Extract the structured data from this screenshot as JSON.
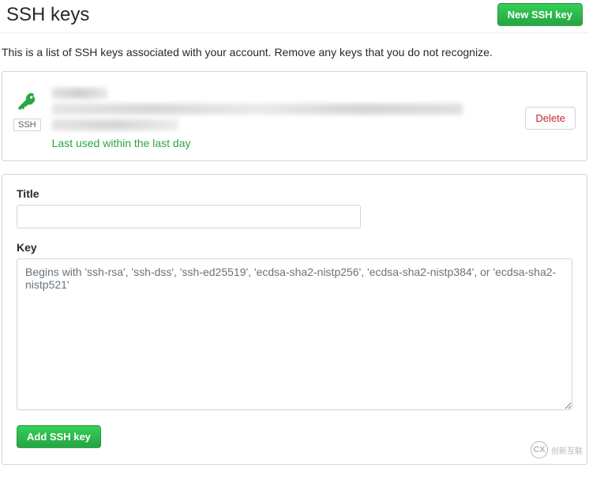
{
  "header": {
    "title": "SSH keys",
    "new_button": "New SSH key"
  },
  "description": "This is a list of SSH keys associated with your account. Remove any keys that you do not recognize.",
  "key_item": {
    "badge": "SSH",
    "last_used": "Last used within the last day",
    "delete_label": "Delete"
  },
  "form": {
    "title_label": "Title",
    "title_value": "",
    "key_label": "Key",
    "key_value": "",
    "key_placeholder": "Begins with 'ssh-rsa', 'ssh-dss', 'ssh-ed25519', 'ecdsa-sha2-nistp256', 'ecdsa-sha2-nistp384', or 'ecdsa-sha2-nistp521'",
    "submit_label": "Add SSH key"
  },
  "watermark": {
    "logo_text": "CX",
    "text": "创新互联"
  }
}
